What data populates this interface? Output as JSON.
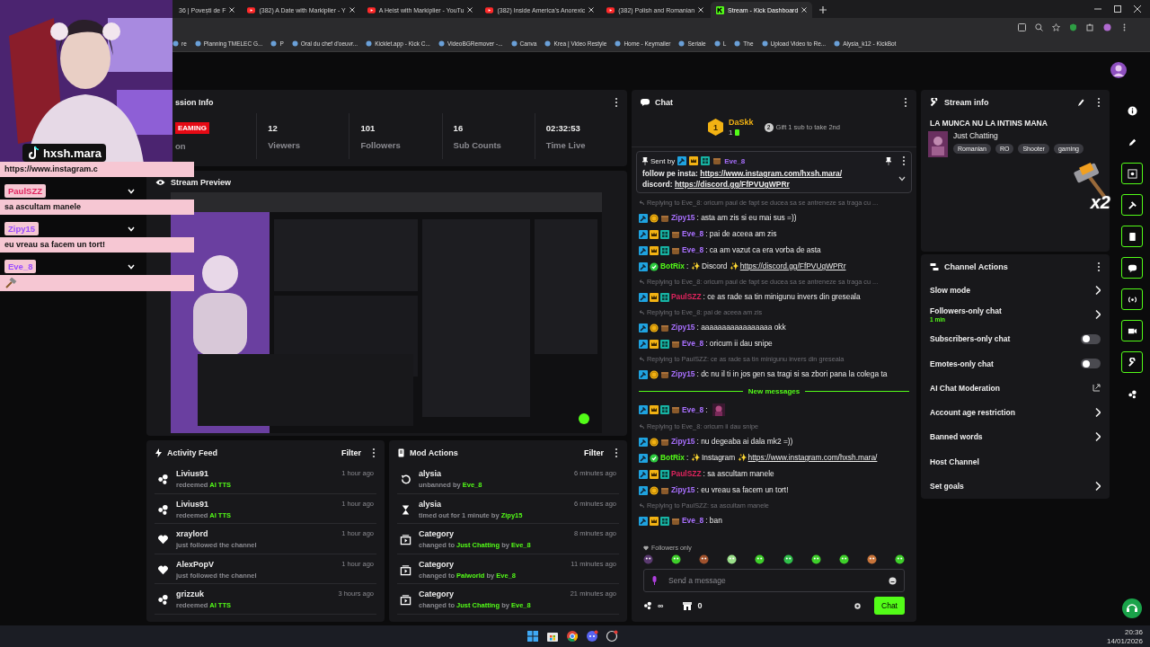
{
  "browser": {
    "tabs": [
      {
        "title": "36 | Povești de F",
        "kind": "plain",
        "selected": false
      },
      {
        "title": "(382) A Date with Markiplier - Y",
        "kind": "video",
        "selected": false
      },
      {
        "title": "A Heist with Markiplier - YouTu",
        "kind": "video",
        "selected": false
      },
      {
        "title": "(382) Inside America's Anorexic",
        "kind": "video",
        "selected": false
      },
      {
        "title": "(382) Polish and Romanian",
        "kind": "video",
        "selected": false
      },
      {
        "title": "Stream - Kick Dashboard",
        "kind": "kick",
        "selected": true
      }
    ],
    "bookmarks": [
      "re",
      "Planning TMELEC G...",
      "P",
      "Oral du chef d'oeuvr...",
      "Kicklet.app - Kick C...",
      "VideoBGRemover -...",
      "Canva",
      "Krea | Video Restyle",
      "Home - Keymailer",
      "Seriale",
      "L",
      "The",
      "Upload Video to Re...",
      "Alysia_k12 - KickBot"
    ]
  },
  "overlay": {
    "streamer": "hxsh.mara",
    "messages": [
      {
        "kind": "text",
        "text": "https://www.instagram.c"
      },
      {
        "kind": "name",
        "text": "PaulSZZ",
        "color": "#e0245e"
      },
      {
        "kind": "text",
        "text": "sa ascultam manele"
      },
      {
        "kind": "name",
        "text": "Zipy15",
        "color": "#9b4dff"
      },
      {
        "kind": "text",
        "text": "eu vreau sa facem un tort!"
      },
      {
        "kind": "name",
        "text": "Eve_8",
        "color": "#9b4dff"
      },
      {
        "kind": "emote"
      }
    ]
  },
  "session": {
    "title": "ssion Info",
    "badge": "EAMING",
    "status": "on",
    "stats": [
      {
        "value": "12",
        "label": "Viewers"
      },
      {
        "value": "101",
        "label": "Followers"
      },
      {
        "value": "16",
        "label": "Sub Counts"
      },
      {
        "value": "02:32:53",
        "label": "Time Live"
      }
    ]
  },
  "preview": {
    "title": "Stream Preview"
  },
  "activity": {
    "title": "Activity Feed",
    "filter": "Filter",
    "items": [
      {
        "kind": "redeem",
        "name": "Livius91",
        "parts": [
          {
            "text": "redeemed",
            "accent": false
          },
          {
            "text": "AI TTS",
            "accent": true
          }
        ],
        "time": "1 hour ago"
      },
      {
        "kind": "redeem",
        "name": "Livius91",
        "parts": [
          {
            "text": "redeemed",
            "accent": false
          },
          {
            "text": "AI TTS",
            "accent": true
          }
        ],
        "time": "1 hour ago"
      },
      {
        "kind": "follow",
        "name": "xraylord",
        "parts": [
          {
            "text": "just followed the channel",
            "accent": false
          }
        ],
        "time": "1 hour ago"
      },
      {
        "kind": "follow",
        "name": "AlexPopV",
        "parts": [
          {
            "text": "just followed the channel",
            "accent": false
          }
        ],
        "time": "1 hour ago"
      },
      {
        "kind": "redeem",
        "name": "grizzuk",
        "parts": [
          {
            "text": "redeemed",
            "accent": false
          },
          {
            "text": "AI TTS",
            "accent": true
          }
        ],
        "time": "3 hours ago"
      }
    ]
  },
  "mod_actions": {
    "title": "Mod Actions",
    "filter": "Filter",
    "items": [
      {
        "kind": "unban",
        "name": "alysia",
        "parts": [
          {
            "text": "unbanned by",
            "accent": false
          },
          {
            "text": "Eve_8",
            "accent": true
          }
        ],
        "time": "6 minutes ago"
      },
      {
        "kind": "timeout",
        "name": "alysia",
        "parts": [
          {
            "text": "timed out for 1 minute by",
            "accent": false
          },
          {
            "text": "Zipy15",
            "accent": true
          }
        ],
        "time": "6 minutes ago"
      },
      {
        "kind": "category",
        "name": "Category",
        "parts": [
          {
            "text": "changed to",
            "accent": false
          },
          {
            "text": "Just Chatting",
            "accent": true
          },
          {
            "text": "by",
            "accent": false
          },
          {
            "text": "Eve_8",
            "accent": true
          }
        ],
        "time": "8 minutes ago"
      },
      {
        "kind": "category",
        "name": "Category",
        "parts": [
          {
            "text": "changed to",
            "accent": false
          },
          {
            "text": "Palworld",
            "accent": true
          },
          {
            "text": "by",
            "accent": false
          },
          {
            "text": "Eve_8",
            "accent": true
          }
        ],
        "time": "11 minutes ago"
      },
      {
        "kind": "category",
        "name": "Category",
        "parts": [
          {
            "text": "changed to",
            "accent": false
          },
          {
            "text": "Just Chatting",
            "accent": true
          },
          {
            "text": "by",
            "accent": false
          },
          {
            "text": "Eve_8",
            "accent": true
          }
        ],
        "time": "21 minutes ago"
      }
    ]
  },
  "chat": {
    "title": "Chat",
    "leader": {
      "rank": "1",
      "name": "DaSkk",
      "count": "1",
      "next_rank": "2",
      "hint": "Gift 1 sub to take 2nd"
    },
    "pinned": {
      "label": "Sent by",
      "badges": [
        {
          "kind": "mod"
        },
        {
          "kind": "crown"
        },
        {
          "kind": "og"
        },
        {
          "kind": "box"
        }
      ],
      "user": "Eve_8",
      "color": "#a970ff",
      "lines": [
        {
          "text": "follow pe insta:",
          "link": "https://www.instagram.com/hxsh.mara/"
        },
        {
          "text": "discord:",
          "link": "https://discord.gg/FfPVUgWPRr"
        }
      ]
    },
    "messages": [
      {
        "reply": "Replying to Eve_8: oricum paul de fapt se ducea sa se antreneze sa traga cu ...",
        "badges": [
          {
            "kind": "mod"
          },
          {
            "kind": "coin"
          },
          {
            "kind": "box"
          }
        ],
        "user": "Zipy15",
        "color": "#a970ff",
        "text": ": asta am zis si eu mai sus =))"
      },
      {
        "badges": [
          {
            "kind": "mod"
          },
          {
            "kind": "crown"
          },
          {
            "kind": "og"
          },
          {
            "kind": "box"
          }
        ],
        "user": "Eve_8",
        "color": "#a970ff",
        "text": ": pai de aceea am zis"
      },
      {
        "badges": [
          {
            "kind": "mod"
          },
          {
            "kind": "crown"
          },
          {
            "kind": "og"
          },
          {
            "kind": "box"
          }
        ],
        "user": "Eve_8",
        "color": "#a970ff",
        "text": ": ca am vazut ca era vorba de asta"
      },
      {
        "badges": [
          {
            "kind": "mod"
          },
          {
            "kind": "verified"
          }
        ],
        "user": "BotRix",
        "color": "#53fc18",
        "text": ": ✨ Discord ✨",
        "link": "https://discord.gg/FfPVUgWPRr"
      },
      {
        "reply": "Replying to Eve_8: oricum paul de fapt se ducea sa se antreneze sa traga cu ...",
        "badges": [
          {
            "kind": "mod"
          },
          {
            "kind": "crown"
          },
          {
            "kind": "og"
          }
        ],
        "user": "PaulSZZ",
        "color": "#e0245e",
        "text": ": ce as rade sa tin minigunu invers din greseala"
      },
      {
        "reply": "Replying to Eve_8: pai de aceea am zis",
        "badges": [
          {
            "kind": "mod"
          },
          {
            "kind": "coin"
          },
          {
            "kind": "box"
          }
        ],
        "user": "Zipy15",
        "color": "#a970ff",
        "text": ": aaaaaaaaaaaaaaaaa okk"
      },
      {
        "badges": [
          {
            "kind": "mod"
          },
          {
            "kind": "crown"
          },
          {
            "kind": "og"
          },
          {
            "kind": "box"
          }
        ],
        "user": "Eve_8",
        "color": "#a970ff",
        "text": ": oricum ii dau snipe"
      },
      {
        "reply": "Replying to PaulSZZ: ce as rade sa tin minigunu invers din greseala",
        "badges": [
          {
            "kind": "mod"
          },
          {
            "kind": "coin"
          },
          {
            "kind": "box"
          }
        ],
        "user": "Zipy15",
        "color": "#a970ff",
        "text": ": dc nu il ti in jos gen sa tragi si sa zbori pana la colega ta",
        "divider_after": "New messages"
      },
      {
        "badges": [
          {
            "kind": "mod"
          },
          {
            "kind": "crown"
          },
          {
            "kind": "og"
          },
          {
            "kind": "box"
          }
        ],
        "user": "Eve_8",
        "color": "#a970ff",
        "text": ":",
        "emote": true
      },
      {
        "reply": "Replying to Eve_8: oricum ii dau snipe",
        "badges": [
          {
            "kind": "mod"
          },
          {
            "kind": "coin"
          },
          {
            "kind": "box"
          }
        ],
        "user": "Zipy15",
        "color": "#a970ff",
        "text": ": nu degeaba ai dala mk2 =))"
      },
      {
        "badges": [
          {
            "kind": "mod"
          },
          {
            "kind": "verified"
          }
        ],
        "user": "BotRix",
        "color": "#53fc18",
        "text": ": ✨ Instagram ✨",
        "link": "https://www.instagram.com/hxsh.mara/"
      },
      {
        "badges": [
          {
            "kind": "mod"
          },
          {
            "kind": "crown"
          },
          {
            "kind": "og"
          }
        ],
        "user": "PaulSZZ",
        "color": "#e0245e",
        "text": ": sa ascultam manele"
      },
      {
        "badges": [
          {
            "kind": "mod"
          },
          {
            "kind": "coin"
          },
          {
            "kind": "box"
          }
        ],
        "user": "Zipy15",
        "color": "#a970ff",
        "text": ": eu vreau sa facem un tort!"
      },
      {
        "reply": "Replying to PaulSZZ: sa ascultam manele",
        "badges": [
          {
            "kind": "mod"
          },
          {
            "kind": "crown"
          },
          {
            "kind": "og"
          },
          {
            "kind": "box"
          }
        ],
        "user": "Eve_8",
        "color": "#a970ff",
        "text": ": ban"
      }
    ],
    "mode": "Followers only",
    "placeholder": "Send a message",
    "points": "∞",
    "store_count": "0",
    "send": "Chat"
  },
  "stream_info": {
    "title": "Stream info",
    "stream_title": "LA MUNCA NU LA INTINS MANA",
    "category": "Just Chatting",
    "tags": [
      "Romanian",
      "RO",
      "Shooter",
      "gaming"
    ]
  },
  "channel_actions": {
    "title": "Channel Actions",
    "items": [
      {
        "kind": "arrow",
        "label": "Slow mode"
      },
      {
        "kind": "arrow",
        "label": "Followers-only chat",
        "detail": "1 min"
      },
      {
        "kind": "toggle",
        "label": "Subscribers-only chat",
        "on": false
      },
      {
        "kind": "toggle",
        "label": "Emotes-only chat",
        "on": false
      },
      {
        "kind": "external",
        "label": "AI Chat Moderation"
      },
      {
        "kind": "arrow",
        "label": "Account age restriction"
      },
      {
        "kind": "arrow",
        "label": "Banned words"
      },
      {
        "kind": "plain",
        "label": "Host Channel"
      },
      {
        "kind": "arrow",
        "label": "Set goals"
      }
    ]
  },
  "sticker": {
    "text": "x2"
  },
  "taskbar": {
    "time": "20:36",
    "date": "14/01/2026"
  }
}
